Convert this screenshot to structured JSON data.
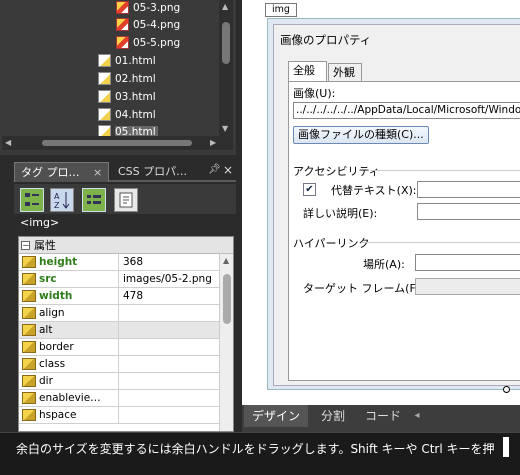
{
  "file_tree": {
    "items": [
      {
        "name": "05-3.png",
        "type": "png"
      },
      {
        "name": "05-4.png",
        "type": "png"
      },
      {
        "name": "05-5.png",
        "type": "png"
      },
      {
        "name": "01.html",
        "type": "html"
      },
      {
        "name": "02.html",
        "type": "html"
      },
      {
        "name": "03.html",
        "type": "html"
      },
      {
        "name": "04.html",
        "type": "html"
      },
      {
        "name": "05.html",
        "type": "html",
        "selected": true
      }
    ]
  },
  "panel": {
    "tab1_label": "タグ プロ…",
    "tab1_close": "×",
    "tab2_label": "CSS プロパ…",
    "pin_icon": "pin-icon",
    "close_icon": "×",
    "tag_label": "<img>",
    "toolbar_icons": [
      "categorized-icon",
      "sort-az-icon",
      "show-set-props-icon",
      "properties-page-icon"
    ]
  },
  "properties": {
    "section_toggle": "－",
    "section_label": "属性",
    "rows": [
      {
        "name": "height",
        "value": "368",
        "bold": true
      },
      {
        "name": "src",
        "value": "images/05-2.png",
        "bold": true
      },
      {
        "name": "width",
        "value": "478",
        "bold": true
      },
      {
        "name": "align",
        "value": ""
      },
      {
        "name": "alt",
        "value": "",
        "highlight": true
      },
      {
        "name": "border",
        "value": ""
      },
      {
        "name": "class",
        "value": ""
      },
      {
        "name": "dir",
        "value": ""
      },
      {
        "name": "enablevie…",
        "value": ""
      },
      {
        "name": "hspace",
        "value": ""
      }
    ]
  },
  "editor": {
    "tag_badge": "img"
  },
  "dialog": {
    "title": "画像のプロパティ",
    "tabs": [
      "全般",
      "外観"
    ],
    "image_label": "画像(U):",
    "image_path": "../../../../../../AppData/Local/Microsoft/Windo",
    "image_type_button": "画像ファイルの種類(C)...",
    "accessibility_heading": "アクセシビリティ",
    "alt_text_checked": true,
    "alt_text_label": "代替テキスト(X):",
    "long_desc_label": "詳しい説明(E):",
    "hyperlink_heading": "ハイパーリンク",
    "location_label": "場所(A):",
    "target_frame_label": "ターゲット フレーム(F):"
  },
  "view_tabs": {
    "design": "デザイン",
    "split": "分割",
    "code": "コード",
    "arrow": "◂"
  },
  "status_bar": {
    "message": "余白のサイズを変更するには余白ハンドルをドラッグします。Shift キーや Ctrl キーを押"
  }
}
